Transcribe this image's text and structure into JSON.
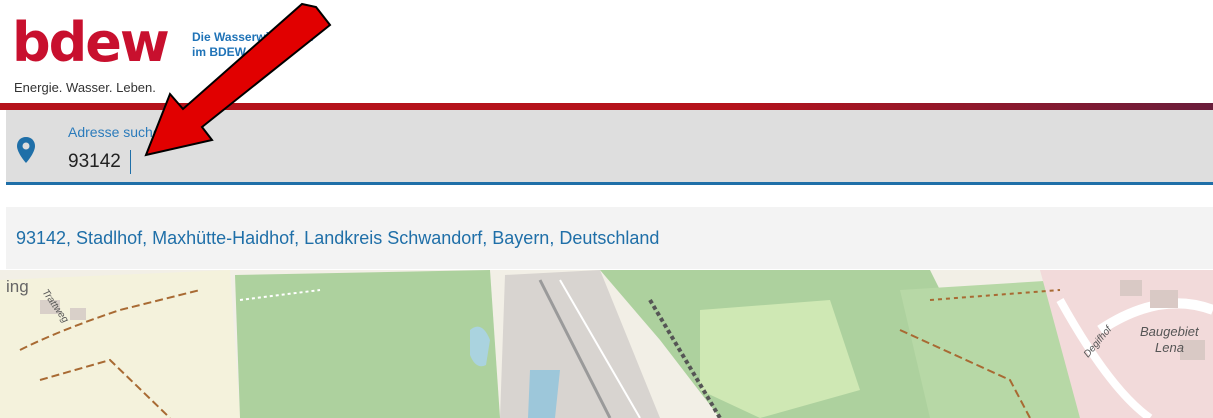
{
  "header": {
    "logo_word": "bdew",
    "logo_tagline": "Energie. Wasser. Leben.",
    "side_line1": "Die Wasserwirtschaft",
    "side_line2": "im BDEW"
  },
  "search": {
    "label": "Adresse suchen",
    "value": "93142",
    "icon": "map-pin-icon"
  },
  "suggestions": [
    {
      "label": "93142, Stadlhof, Maxhütte-Haidhof, Landkreis Schwandorf, Bayern, Deutschland"
    }
  ],
  "map": {
    "labels": {
      "top_left": "ing",
      "street_1": "Trattweg",
      "street_2": "Degifhof",
      "area_1": "Baugebiet",
      "area_2": "Lena"
    }
  },
  "colors": {
    "brand_red": "#c8102e",
    "link_blue": "#1f6fa8",
    "annotation_arrow": "#e10000"
  }
}
